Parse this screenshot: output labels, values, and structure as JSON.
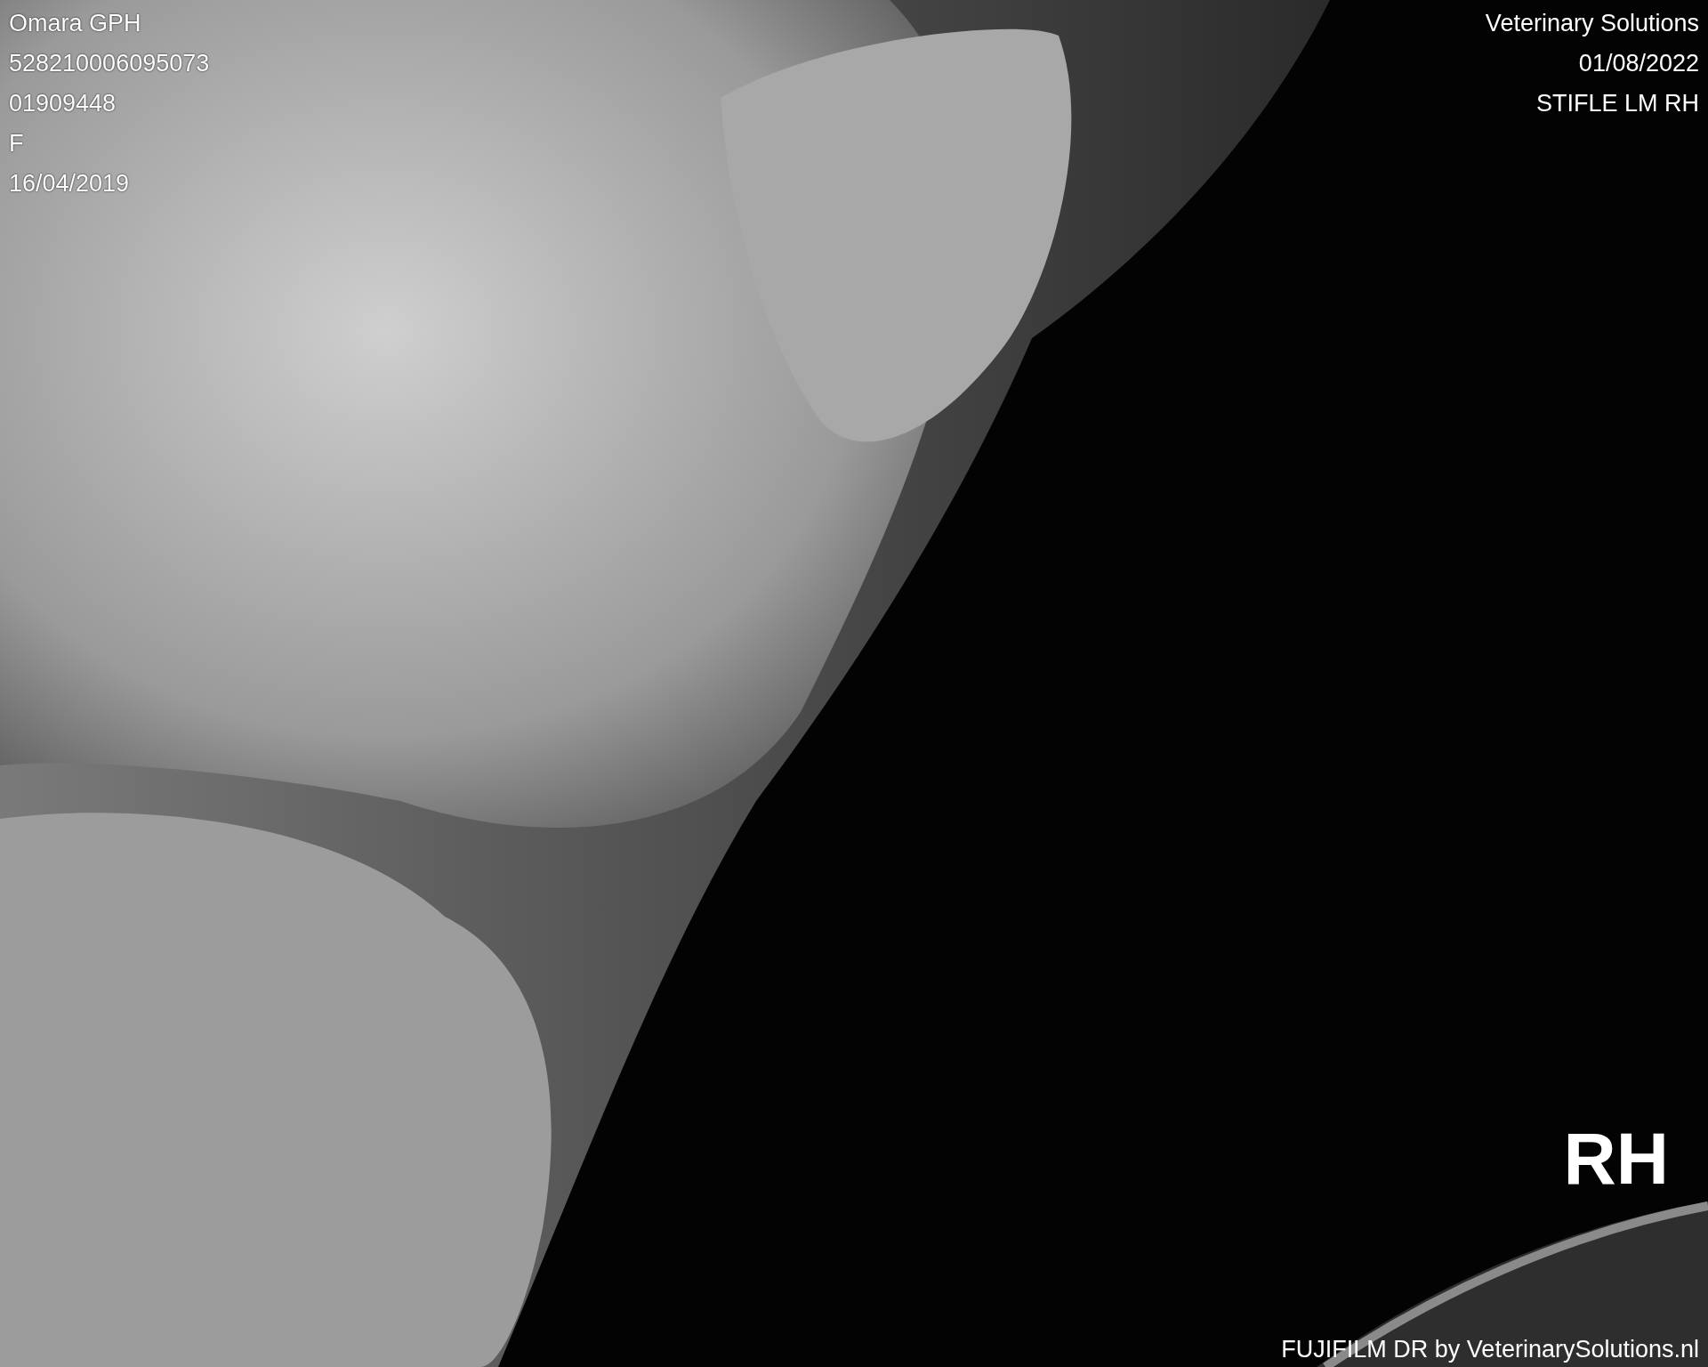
{
  "patient_info": [
    "Omara GPH",
    "528210006095073",
    "01909448",
    "F",
    "16/04/2019"
  ],
  "study_info": [
    "Veterinary Solutions",
    "01/08/2022",
    "STIFLE LM RH"
  ],
  "side_marker": "RH",
  "footer": "FUJIFILM DR by VeterinarySolutions.nl"
}
